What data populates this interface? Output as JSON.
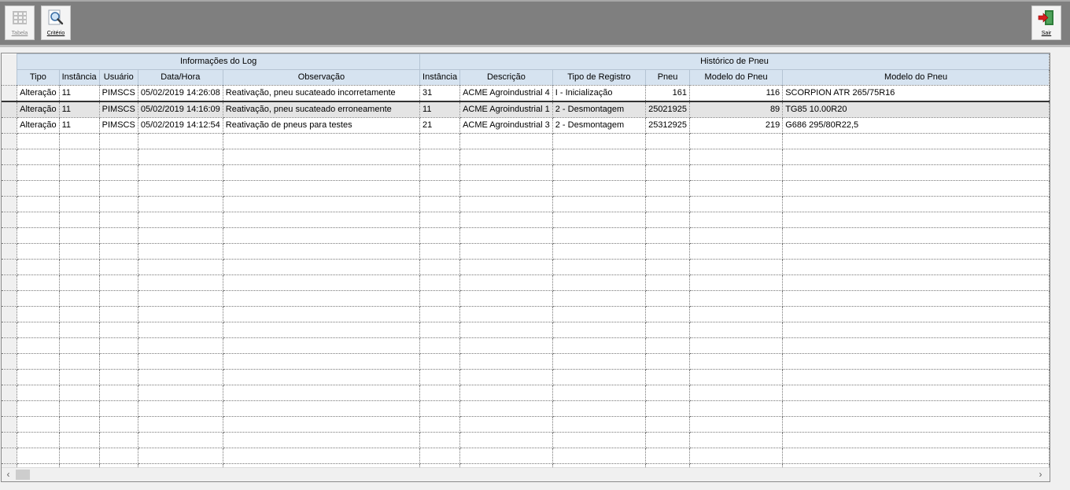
{
  "toolbar": {
    "tabela_label": "Tabela",
    "criterio_label": "Critério",
    "sair_label": "Sair"
  },
  "grid": {
    "groups": [
      "Informações do Log",
      "Histórico de Pneu"
    ],
    "columns": [
      "Tipo",
      "Instância",
      "Usuário",
      "Data/Hora",
      "Observação",
      "Instância",
      "Descrição",
      "Tipo de Registro",
      "Pneu",
      "Modelo do Pneu",
      "Modelo do Pneu"
    ],
    "rows": [
      [
        "Alteração",
        "11",
        "PIMSCS",
        "05/02/2019 14:26:08",
        "Reativação, pneu sucateado incorretamente",
        "31",
        "ACME Agroindustrial 4",
        "I - Inicialização",
        "161",
        "116",
        "SCORPION ATR 265/75R16"
      ],
      [
        "Alteração",
        "11",
        "PIMSCS",
        "05/02/2019 14:16:09",
        "Reativação, pneu sucateado erroneamente",
        "11",
        "ACME Agroindustrial 1",
        "2 - Desmontagem",
        "25021925",
        "89",
        "TG85 10.00R20"
      ],
      [
        "Alteração",
        "11",
        "PIMSCS",
        "05/02/2019 14:12:54",
        "Reativação de pneus para testes",
        "21",
        "ACME Agroindustrial 3",
        "2 - Desmontagem",
        "25312925",
        "219",
        "G686 295/80R22,5"
      ]
    ]
  }
}
